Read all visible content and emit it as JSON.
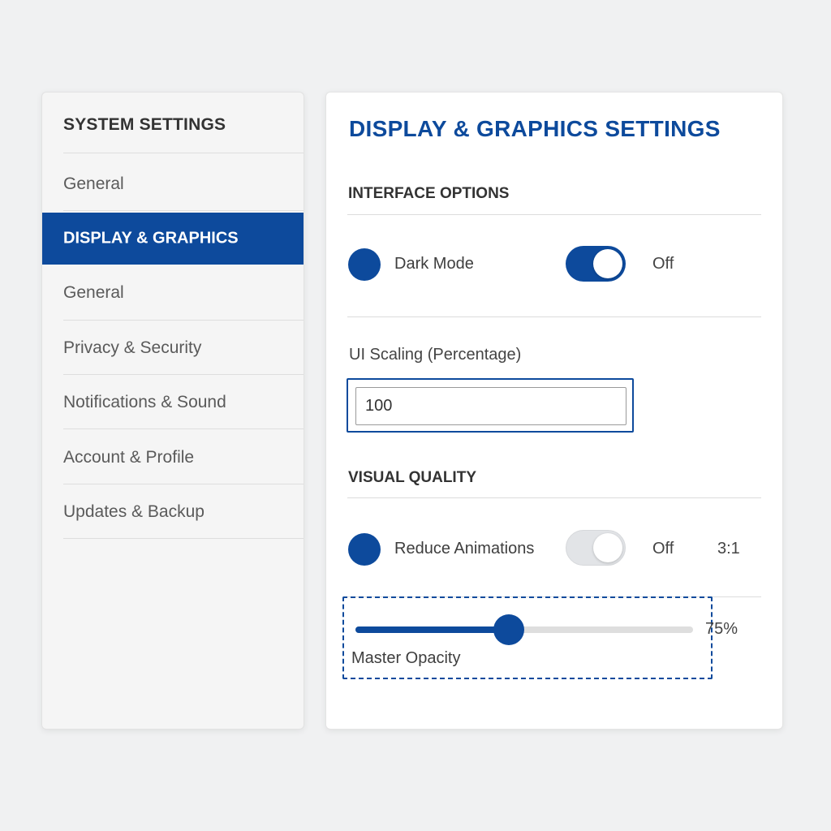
{
  "sidebar": {
    "title": "SYSTEM SETTINGS",
    "items": [
      {
        "label": "General"
      },
      {
        "label": "DISPLAY & GRAPHICS",
        "active": true
      },
      {
        "label": "General"
      },
      {
        "label": "Privacy & Security"
      },
      {
        "label": "Notifications & Sound"
      },
      {
        "label": "Account & Profile"
      },
      {
        "label": "Updates & Backup"
      }
    ]
  },
  "main": {
    "title": "DISPLAY & GRAPHICS SETTINGS",
    "interface_section": {
      "heading": "INTERFACE OPTIONS",
      "dark_mode": {
        "label": "Dark Mode",
        "toggle_on": true,
        "state_text": "Off"
      },
      "ui_scaling": {
        "label": "UI Scaling (Percentage)",
        "value": "100"
      }
    },
    "visual_section": {
      "heading": "VISUAL QUALITY",
      "reduce_animations": {
        "label": "Reduce Animations",
        "toggle_on": false,
        "state_text": "Off",
        "ratio": "3:1"
      },
      "master_opacity": {
        "label": "Master Opacity",
        "value": 75,
        "value_text": "75%"
      }
    }
  },
  "colors": {
    "accent": "#0d4a9c",
    "page_bg": "#f0f1f2",
    "panel_bg": "#ffffff",
    "sidebar_bg": "#f5f5f5"
  }
}
